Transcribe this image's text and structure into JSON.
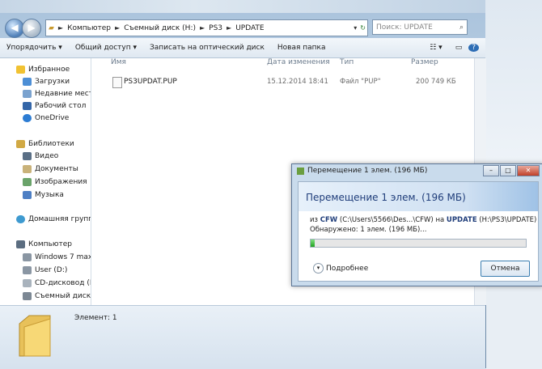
{
  "address": {
    "crumbs": [
      "Компьютер",
      "Съемный диск (H:)",
      "PS3",
      "UPDATE"
    ],
    "search_placeholder": "Поиск: UPDATE"
  },
  "toolbar": {
    "organize": "Упорядочить ▾",
    "share": "Общий доступ ▾",
    "burn": "Записать на оптический диск",
    "new_folder": "Новая папка"
  },
  "nav": {
    "favorites": "Избранное",
    "downloads": "Загрузки",
    "recent": "Недавние места",
    "desktop": "Рабочий стол",
    "onedrive": "OneDrive",
    "libraries": "Библиотеки",
    "video": "Видео",
    "documents": "Документы",
    "images": "Изображения",
    "music": "Музыка",
    "homegroup": "Домашняя группа",
    "computer": "Компьютер",
    "drive_c": "Windows 7 max-(",
    "drive_d": "User (D:)",
    "drive_f": "CD-дисковод (F:)",
    "drive_h": "Съемный диск (I"
  },
  "columns": {
    "name": "Имя",
    "date": "Дата изменения",
    "type": "Тип",
    "size": "Размер"
  },
  "file": {
    "name": "PS3UPDAT.PUP",
    "date": "15.12.2014 18:41",
    "type": "Файл \"PUP\"",
    "size": "200 749 КБ"
  },
  "status": {
    "items": "Элемент: 1"
  },
  "dialog": {
    "title": "Перемещение 1 элем. (196 МБ)",
    "heading": "Перемещение 1 элем. (196 МБ)",
    "from_prefix": "из",
    "from_name": "CFW",
    "from_path": "(C:\\Users\\5566\\Des...\\CFW)",
    "to_prefix": "на",
    "to_name": "UPDATE",
    "to_path": "(H:\\PS3\\UPDATE)",
    "found": "Обнаружено: 1 элем. (196 МБ)...",
    "progress": 0.02,
    "more": "Подробнее",
    "cancel": "Отмена"
  }
}
